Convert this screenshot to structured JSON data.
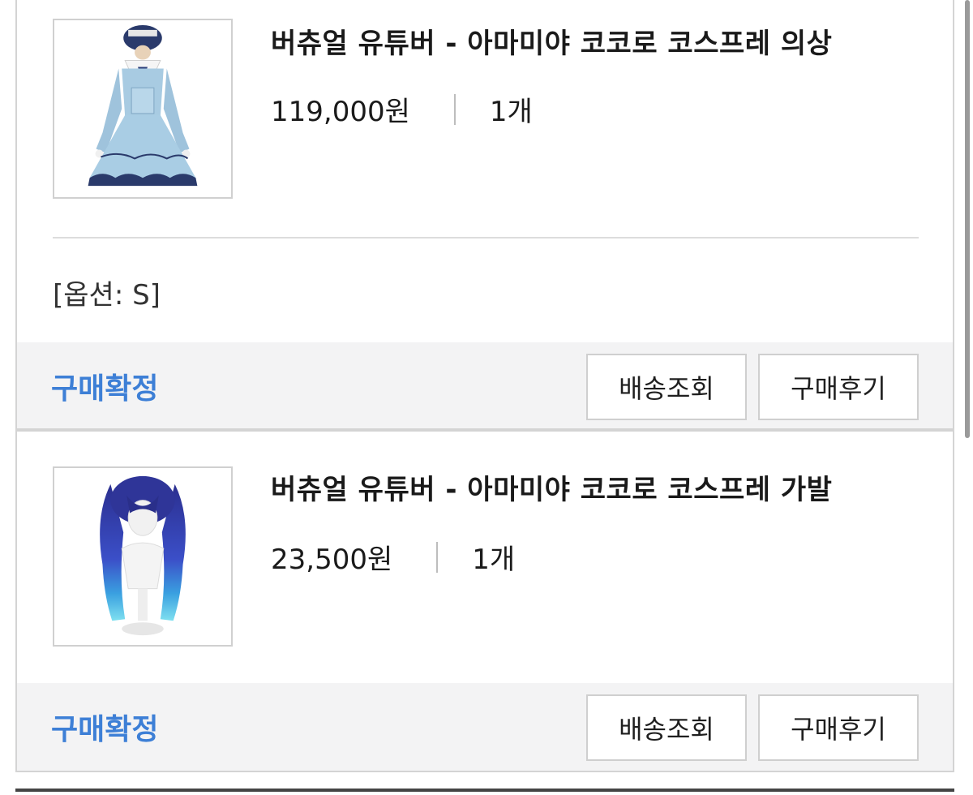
{
  "orders": [
    {
      "product_name": "버츄얼 유튜버 - 아마미야 코코로 코스프레 의상",
      "price": "119,000원",
      "quantity": "1개",
      "option": "[옵션: S]",
      "status": "구매확정",
      "track_button": "배송조회",
      "review_button": "구매후기",
      "image_icon": "costume-dress-image"
    },
    {
      "product_name": "버츄얼 유튜버 - 아마미야 코코로 코스프레 가발",
      "price": "23,500원",
      "quantity": "1개",
      "status": "구매확정",
      "track_button": "배송조회",
      "review_button": "구매후기",
      "image_icon": "wig-image"
    }
  ],
  "colors": {
    "status_blue": "#3d7fd6",
    "action_bar_bg": "#f3f3f4",
    "border": "#d4d4d4"
  }
}
